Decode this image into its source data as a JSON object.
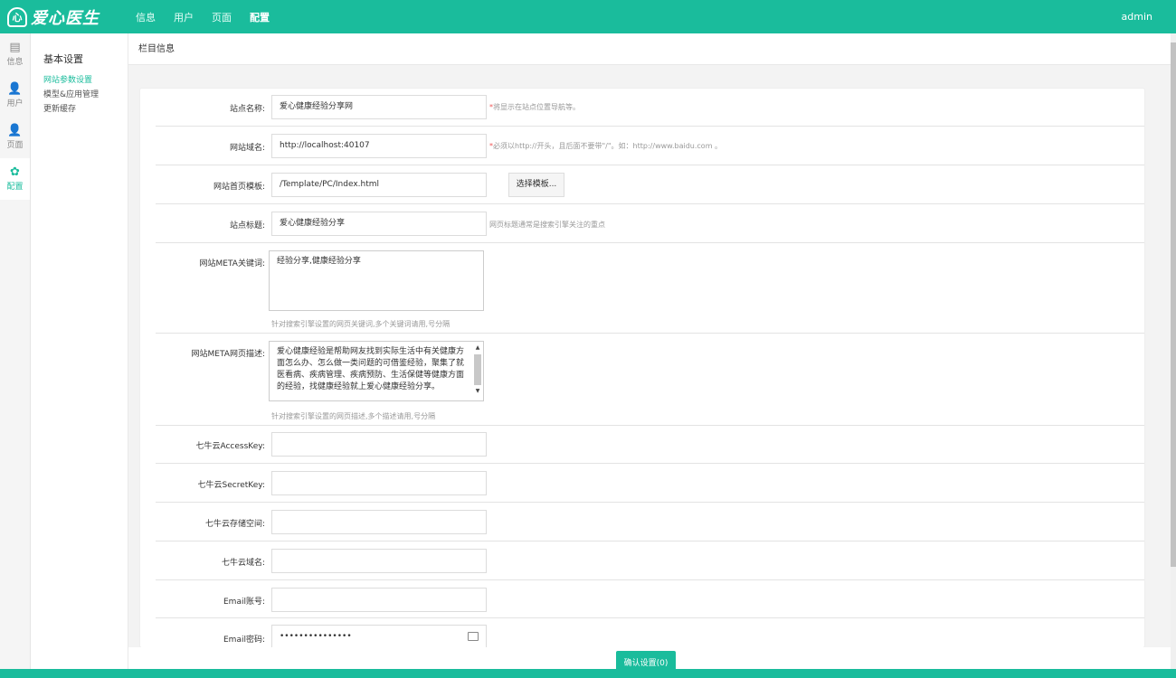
{
  "header": {
    "logo_mark": "心",
    "logo_text": "爱心医生",
    "nav": [
      "信息",
      "用户",
      "页面",
      "配置"
    ],
    "active_nav": 3,
    "user": "admin"
  },
  "iconbar": [
    {
      "icon": "document-icon",
      "glyph": "▤",
      "label": "信息"
    },
    {
      "icon": "user-icon",
      "glyph": "👤",
      "label": "用户"
    },
    {
      "icon": "page-icon",
      "glyph": "👤",
      "label": "页面"
    },
    {
      "icon": "gear-icon",
      "glyph": "✿",
      "label": "配置"
    }
  ],
  "sidebar": {
    "title": "基本设置",
    "links": [
      "网站参数设置",
      "模型&应用管理",
      "更新缓存"
    ]
  },
  "breadcrumb": "栏目信息",
  "form": {
    "site_name": {
      "label": "站点名称:",
      "value": "爱心健康经验分享网",
      "tip_star": "*",
      "tip": "将显示在站点位置导航等。"
    },
    "site_domain": {
      "label": "网站域名:",
      "value": "http://localhost:40107",
      "tip_star": "*",
      "tip": "必须以http://开头，且后面不要带\"/\"。如：http://www.baidu.com 。"
    },
    "home_template": {
      "label": "网站首页模板:",
      "value": "/Template/PC/Index.html",
      "button": "选择模板..."
    },
    "site_title": {
      "label": "站点标题:",
      "value": "爱心健康经验分享",
      "tip": "网页标题通常是搜索引擎关注的重点"
    },
    "meta_keywords": {
      "label": "网站META关键词:",
      "value": "经验分享,健康经验分享",
      "tip": "针对搜索引擎设置的网页关键词,多个关键词请用,号分隔"
    },
    "meta_description": {
      "label": "网站META网页描述:",
      "value": "爱心健康经验是帮助网友找到实际生活中有关健康方面怎么办、怎么做一类问题的可借鉴经验，聚集了就医看病、疾病管理、疾病预防、生活保健等健康方面的经验，找健康经验就上爱心健康经验分享。",
      "tip": "针对搜索引擎设置的网页描述,多个描述请用,号分隔"
    },
    "qiniu_access": {
      "label": "七牛云AccessKey:",
      "value": ""
    },
    "qiniu_secret": {
      "label": "七牛云SecretKey:",
      "value": ""
    },
    "qiniu_bucket": {
      "label": "七牛云存储空间:",
      "value": ""
    },
    "qiniu_domain": {
      "label": "七牛云域名:",
      "value": ""
    },
    "email_account": {
      "label": "Email账号:",
      "value": ""
    },
    "email_password": {
      "label": "Email密码:",
      "value": "•••••••••••••••"
    }
  },
  "submit_label": "确认设置(0)",
  "colors": {
    "accent": "#1abc9c"
  }
}
